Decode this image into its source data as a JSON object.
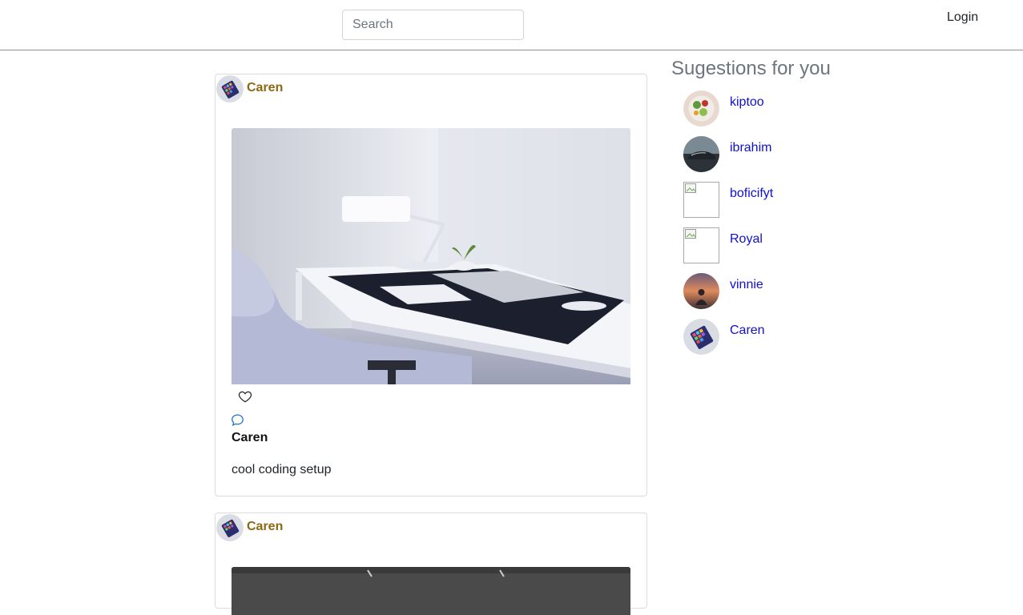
{
  "header": {
    "search_placeholder": "Search",
    "login_label": "Login"
  },
  "posts": [
    {
      "author": "Caren",
      "caption_author": "Caren",
      "caption": "cool coding setup",
      "image": "desk-setup-photo"
    },
    {
      "author": "Caren",
      "image": "office-ceiling-photo"
    }
  ],
  "suggestions": {
    "title": "Sugestions for you",
    "users": [
      {
        "name": "kiptoo",
        "avatar": "food-photo"
      },
      {
        "name": "ibrahim",
        "avatar": "car-photo"
      },
      {
        "name": "boficifyt",
        "avatar": "broken-image"
      },
      {
        "name": "Royal",
        "avatar": "broken-image"
      },
      {
        "name": "vinnie",
        "avatar": "sunset-photo"
      },
      {
        "name": "Caren",
        "avatar": "tablet-photo"
      }
    ]
  },
  "icons": {
    "like": "heart-outline-icon",
    "comment": "speech-bubble-icon"
  },
  "colors": {
    "author_link": "#8b6914",
    "suggestion_link": "#1010d0",
    "comment_icon": "#1a73c8"
  }
}
